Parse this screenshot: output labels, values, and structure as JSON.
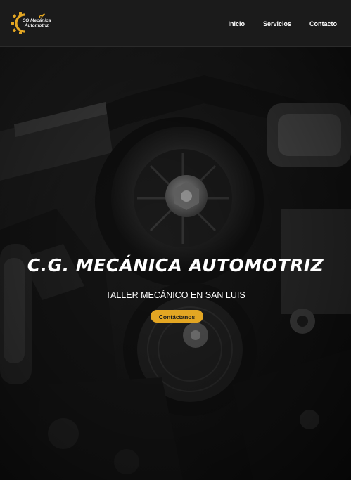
{
  "header": {
    "logo_text_line1": "CG Mecánica",
    "logo_text_line2": "Automotriz",
    "nav": [
      {
        "label": "Inicio"
      },
      {
        "label": "Servicios"
      },
      {
        "label": "Contacto"
      }
    ]
  },
  "hero": {
    "title": "C.G. MECÁNICA AUTOMOTRIZ",
    "subtitle": "TALLER MECÁNICO EN SAN LUIS",
    "cta_label": "Contáctanos"
  },
  "colors": {
    "accent": "#e3a623",
    "header_bg": "#1b1b1b",
    "text": "#ffffff"
  },
  "icons": {
    "logo": "gear-logo-icon"
  }
}
